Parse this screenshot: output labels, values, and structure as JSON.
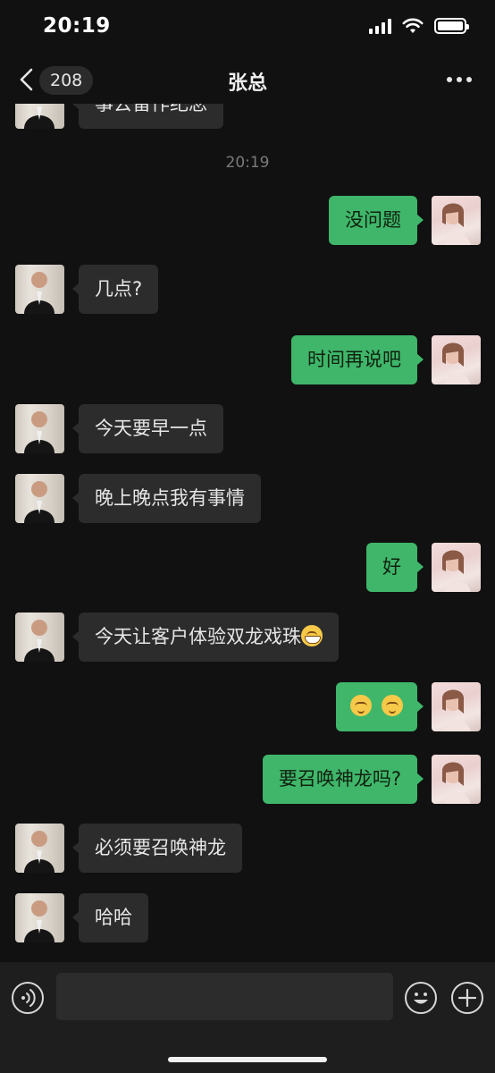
{
  "status_bar": {
    "time": "20:19",
    "icons": [
      "cellular-signal-icon",
      "wifi-icon",
      "battery-icon"
    ]
  },
  "header": {
    "back_icon": "chevron-left-icon",
    "unread_count": "208",
    "title": "张总",
    "more_icon": "more-dots-icon"
  },
  "chat": {
    "partial_message": "事去留作纪念",
    "timestamp": "20:19",
    "messages": [
      {
        "from": "me",
        "text": "没问题"
      },
      {
        "from": "contact",
        "text": "几点?"
      },
      {
        "from": "me",
        "text": "时间再说吧"
      },
      {
        "from": "contact",
        "text": "今天要早一点"
      },
      {
        "from": "contact",
        "text": "晚上晚点我有事情"
      },
      {
        "from": "me",
        "text": "好"
      },
      {
        "from": "contact",
        "text": "今天让客户体验双龙戏珠",
        "emoji": "grinning-emoji"
      },
      {
        "from": "me",
        "text": "",
        "emoji": "blushing-emoji x2"
      },
      {
        "from": "me",
        "text": "要召唤神龙吗?"
      },
      {
        "from": "contact",
        "text": "必须要召唤神龙"
      },
      {
        "from": "contact",
        "text": "哈哈"
      }
    ]
  },
  "input_bar": {
    "voice_icon": "voice-icon",
    "input_value": "",
    "emoji_icon": "emoji-icon",
    "plus_icon": "plus-icon"
  },
  "colors": {
    "background": "#111111",
    "outgoing_bubble": "#3fb66a",
    "incoming_bubble": "#2c2c2c",
    "input_bar": "#1e1e1e"
  }
}
